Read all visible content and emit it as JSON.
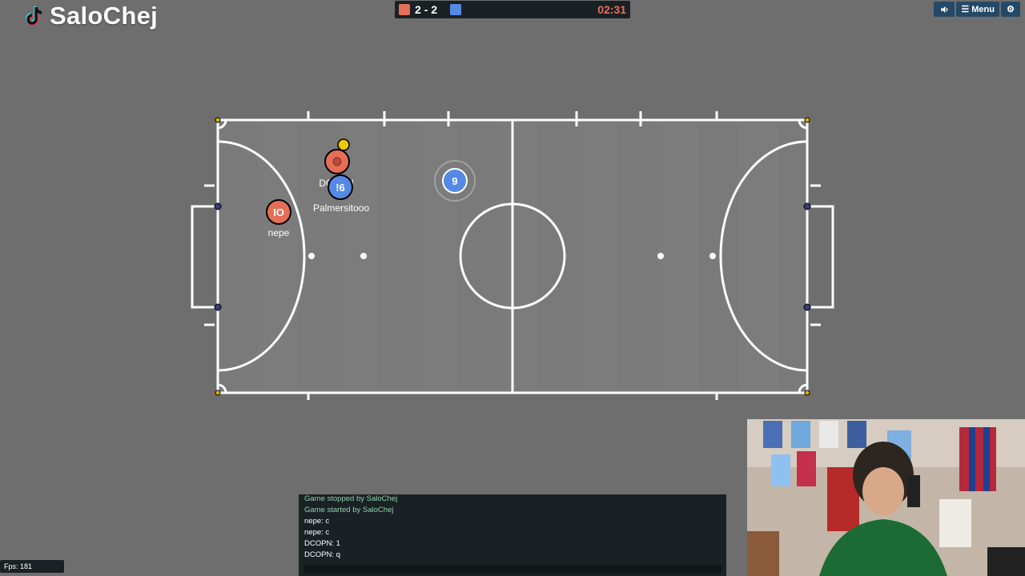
{
  "overlay": {
    "channel": "SaloChej",
    "logo_icon": "tiktok-icon"
  },
  "scoreboard": {
    "red_score": "2",
    "separator": "-",
    "blue_score": "2",
    "time": "02:31",
    "red_color": "#e56e56",
    "blue_color": "#5689e5"
  },
  "toolbar": {
    "sound_icon": "speaker-icon",
    "menu_label": "Menu",
    "settings_icon": "gear-icon"
  },
  "players": [
    {
      "number": "IO",
      "name": "nepe",
      "team": "red"
    },
    {
      "number": "",
      "name": "DCOPN",
      "team": "red"
    },
    {
      "number": "!6",
      "name": "Palmersitooo",
      "team": "blue"
    },
    {
      "number": "9",
      "name": "",
      "team": "blue"
    }
  ],
  "chat": [
    {
      "text": "Game stopped by SaloChej",
      "type": "system"
    },
    {
      "text": "Game started by SaloChej",
      "type": "system"
    },
    {
      "text": "nepe: c",
      "type": "player"
    },
    {
      "text": "nepe: c",
      "type": "player"
    },
    {
      "text": "DCOPN: 1",
      "type": "player"
    },
    {
      "text": "DCOPN: q",
      "type": "player"
    }
  ],
  "fps": "Fps: 181"
}
